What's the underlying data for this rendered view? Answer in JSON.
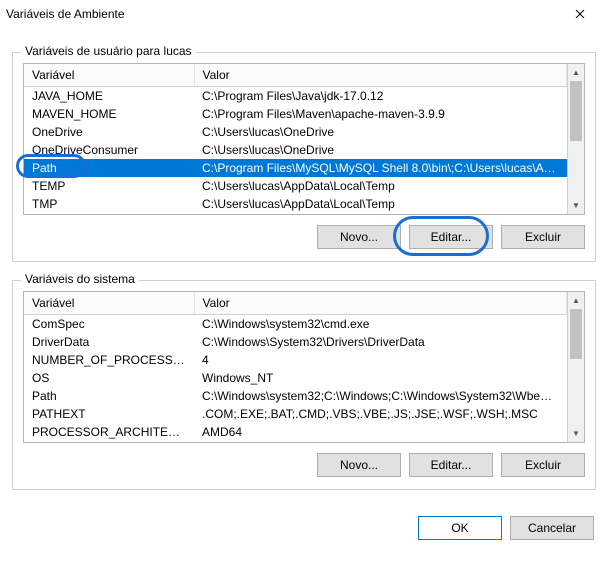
{
  "window": {
    "title": "Variáveis de Ambiente"
  },
  "user_vars": {
    "label": "Variáveis de usuário para lucas",
    "headers": {
      "var": "Variável",
      "val": "Valor"
    },
    "rows": [
      {
        "var": "JAVA_HOME",
        "val": "C:\\Program Files\\Java\\jdk-17.0.12"
      },
      {
        "var": "MAVEN_HOME",
        "val": "C:\\Program Files\\Maven\\apache-maven-3.9.9"
      },
      {
        "var": "OneDrive",
        "val": "C:\\Users\\lucas\\OneDrive"
      },
      {
        "var": "OneDriveConsumer",
        "val": "C:\\Users\\lucas\\OneDrive"
      },
      {
        "var": "Path",
        "val": "C:\\Program Files\\MySQL\\MySQL Shell 8.0\\bin\\;C:\\Users\\lucas\\App..."
      },
      {
        "var": "TEMP",
        "val": "C:\\Users\\lucas\\AppData\\Local\\Temp"
      },
      {
        "var": "TMP",
        "val": "C:\\Users\\lucas\\AppData\\Local\\Temp"
      }
    ],
    "selected_index": 4,
    "buttons": {
      "new": "Novo...",
      "edit": "Editar...",
      "delete": "Excluir"
    }
  },
  "system_vars": {
    "label": "Variáveis do sistema",
    "headers": {
      "var": "Variável",
      "val": "Valor"
    },
    "rows": [
      {
        "var": "ComSpec",
        "val": "C:\\Windows\\system32\\cmd.exe"
      },
      {
        "var": "DriverData",
        "val": "C:\\Windows\\System32\\Drivers\\DriverData"
      },
      {
        "var": "NUMBER_OF_PROCESSORS",
        "val": "4"
      },
      {
        "var": "OS",
        "val": "Windows_NT"
      },
      {
        "var": "Path",
        "val": "C:\\Windows\\system32;C:\\Windows;C:\\Windows\\System32\\Wbem;..."
      },
      {
        "var": "PATHEXT",
        "val": ".COM;.EXE;.BAT;.CMD;.VBS;.VBE;.JS;.JSE;.WSF;.WSH;.MSC"
      },
      {
        "var": "PROCESSOR_ARCHITECTURE",
        "val": "AMD64"
      }
    ],
    "buttons": {
      "new": "Novo...",
      "edit": "Editar...",
      "delete": "Excluir"
    }
  },
  "dialog": {
    "ok": "OK",
    "cancel": "Cancelar"
  },
  "annotations": {
    "path_circle": true,
    "edit_circle": true
  }
}
